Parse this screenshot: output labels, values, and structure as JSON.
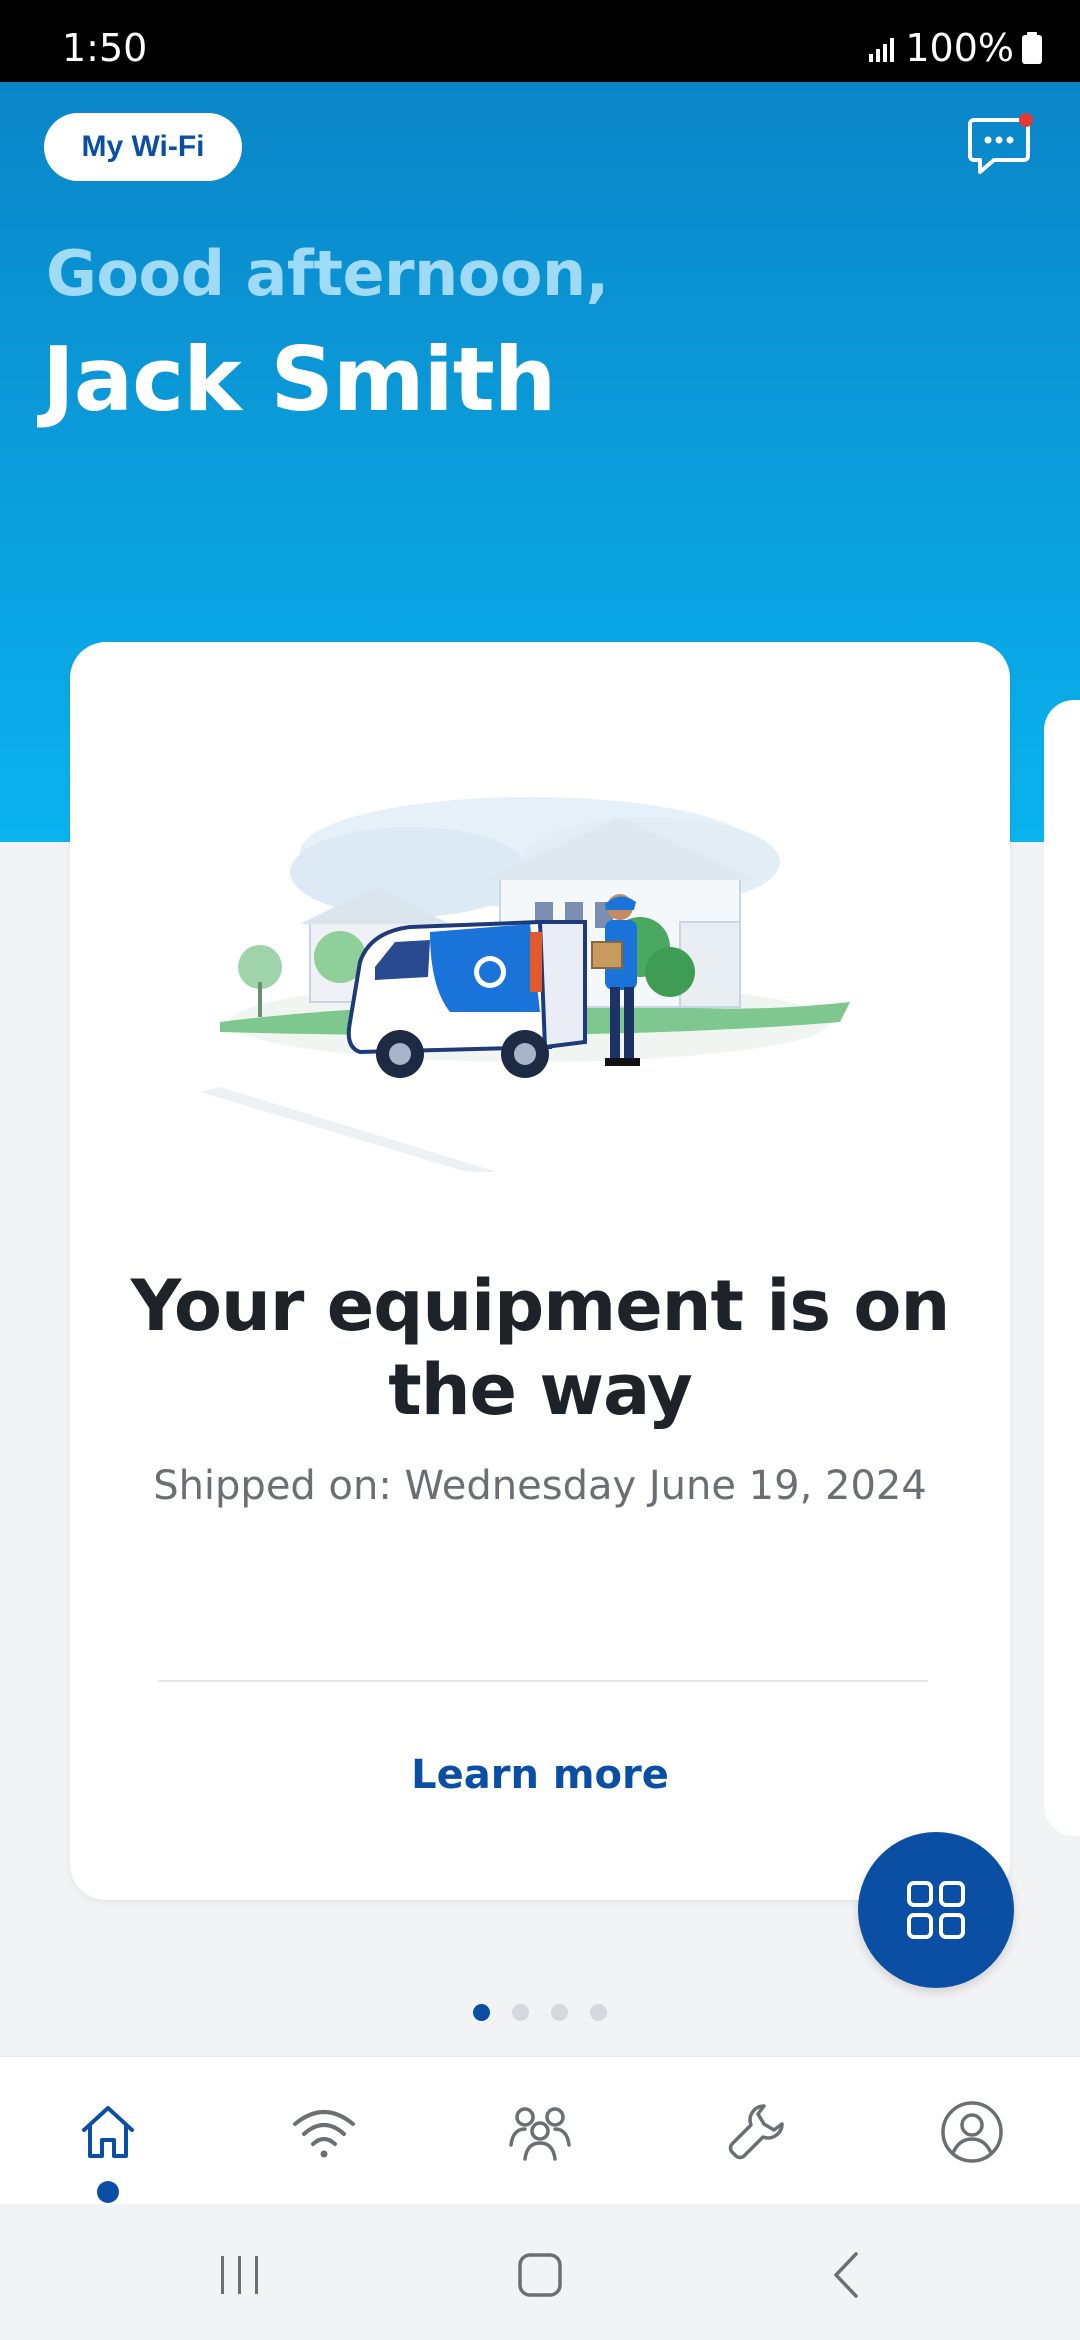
{
  "status_bar": {
    "time": "1:50",
    "battery": "100%"
  },
  "header": {
    "wifi_button_label": "My Wi-Fi",
    "greeting": "Good afternoon,",
    "user_name": "Jack Smith"
  },
  "card": {
    "title": "Your equipment is on the way",
    "subtitle": "Shipped on: Wednesday June 19, 2024",
    "action_label": "Learn more"
  },
  "pager": {
    "count": 4,
    "active_index": 0
  },
  "bottom_nav": {
    "items": [
      {
        "icon": "home-icon",
        "active": true
      },
      {
        "icon": "wifi-icon",
        "active": false
      },
      {
        "icon": "people-icon",
        "active": false
      },
      {
        "icon": "wrench-icon",
        "active": false
      },
      {
        "icon": "profile-icon",
        "active": false
      }
    ]
  },
  "colors": {
    "brand_blue": "#0b4fa5",
    "hero_top": "#0a86c8",
    "hero_bottom": "#0ab3ee",
    "notification_red": "#e53935"
  }
}
